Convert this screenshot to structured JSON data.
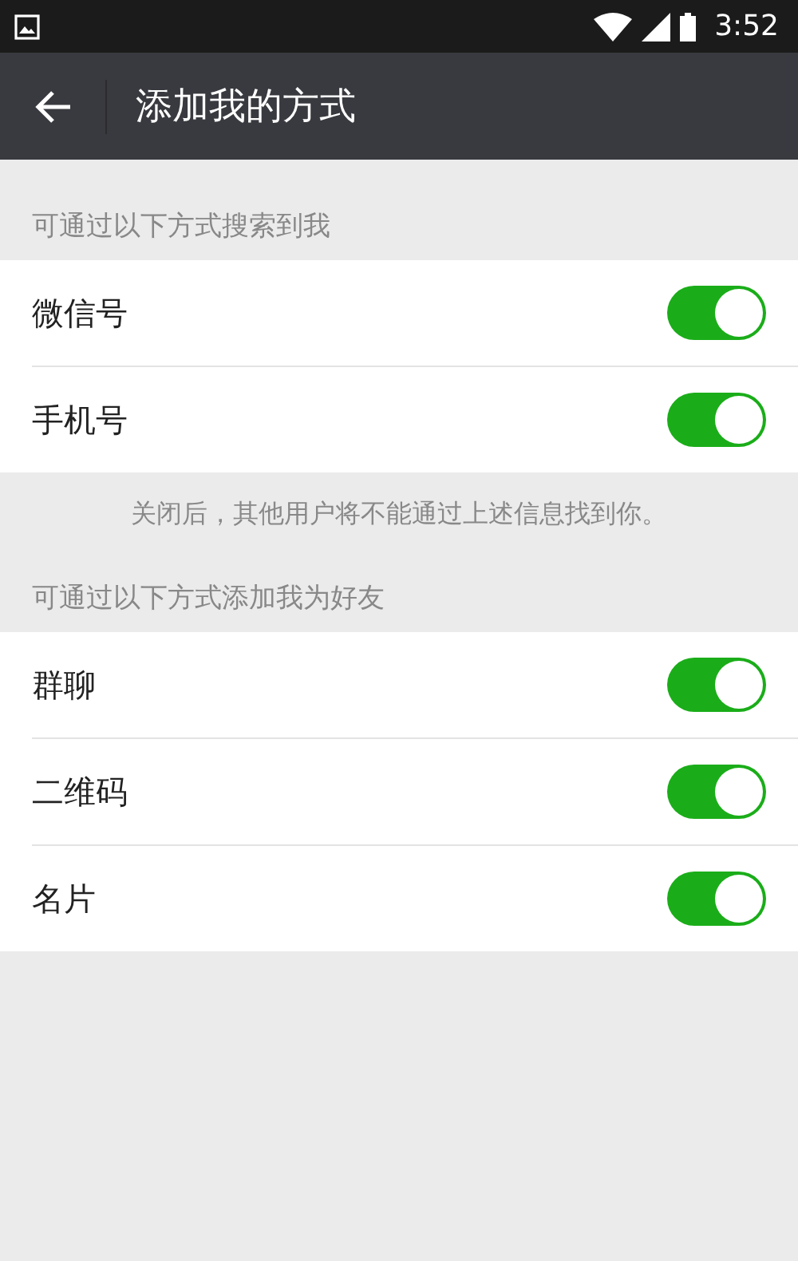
{
  "status_bar": {
    "time": "3:52"
  },
  "header": {
    "title": "添加我的方式"
  },
  "sections": [
    {
      "heading": "可通过以下方式搜索到我",
      "rows": [
        {
          "label": "微信号",
          "on": true
        },
        {
          "label": "手机号",
          "on": true
        }
      ],
      "note": "关闭后，其他用户将不能通过上述信息找到你。"
    },
    {
      "heading": "可通过以下方式添加我为好友",
      "rows": [
        {
          "label": "群聊",
          "on": true
        },
        {
          "label": "二维码",
          "on": true
        },
        {
          "label": "名片",
          "on": true
        }
      ]
    }
  ]
}
